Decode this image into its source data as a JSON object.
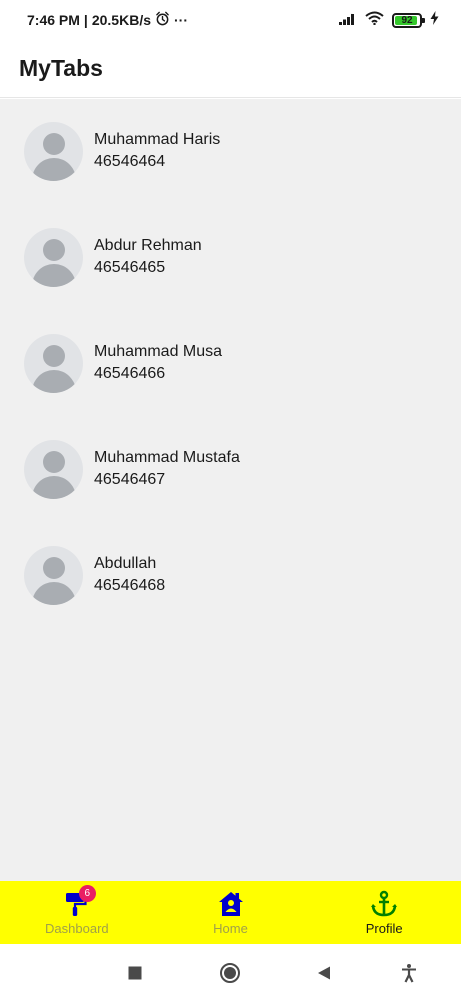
{
  "status_bar": {
    "time": "7:46 PM",
    "network_speed": "20.5KB/s",
    "alarm_icon": "alarm-clock-icon",
    "more": "···",
    "battery_level": "92",
    "battery_percent": 92,
    "battery_color": "#35c82c"
  },
  "app_bar": {
    "title": "MyTabs"
  },
  "contacts": [
    {
      "name": "Muhammad Haris",
      "phone": "46546464"
    },
    {
      "name": "Abdur Rehman",
      "phone": "46546465"
    },
    {
      "name": "Muhammad Musa",
      "phone": "46546466"
    },
    {
      "name": "Muhammad Mustafa",
      "phone": "46546467"
    },
    {
      "name": "Abdullah",
      "phone": "46546468"
    }
  ],
  "tabs": [
    {
      "label": "Dashboard",
      "icon": "paint-roller-icon",
      "badge": "6",
      "active": false
    },
    {
      "label": "Home",
      "icon": "home-icon",
      "active": false
    },
    {
      "label": "Profile",
      "icon": "anchor-icon",
      "active": true
    }
  ],
  "colors": {
    "tab_bar": "#ffff00",
    "content_bg": "#f0f0f0",
    "icon_blue": "#0000cc",
    "icon_green": "#008000",
    "badge": "#e91e63"
  },
  "nav_bar": {
    "icons": [
      "recent-apps-icon",
      "home-circle-icon",
      "back-icon",
      "accessibility-icon"
    ]
  }
}
